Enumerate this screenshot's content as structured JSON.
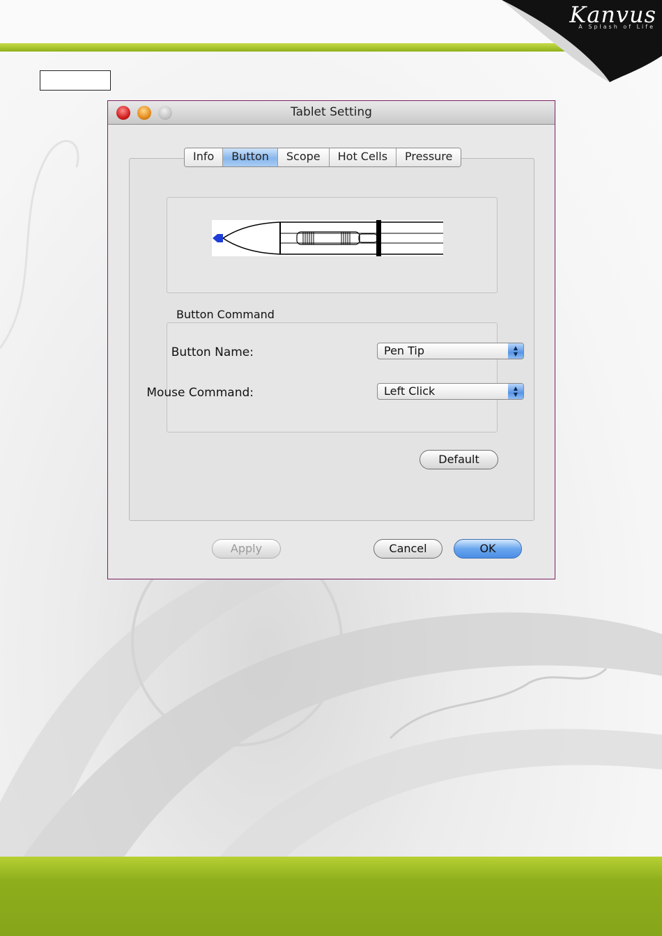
{
  "brand": {
    "name": "Kanvus",
    "tagline": "A Splash of Life"
  },
  "window": {
    "title": "Tablet Setting",
    "tabs": [
      {
        "label": "Info",
        "active": false
      },
      {
        "label": "Button",
        "active": true
      },
      {
        "label": "Scope",
        "active": false
      },
      {
        "label": "Hot Cells",
        "active": false
      },
      {
        "label": "Pressure",
        "active": false
      }
    ],
    "button_command": {
      "group_label": "Button Command",
      "button_name_label": "Button Name:",
      "button_name_value": "Pen Tip",
      "mouse_command_label": "Mouse Command:",
      "mouse_command_value": "Left Click"
    },
    "buttons": {
      "default": "Default",
      "apply": "Apply",
      "cancel": "Cancel",
      "ok": "OK"
    }
  },
  "colors": {
    "accent_green": "#8fb01a",
    "selection_blue": "#6aa6ee",
    "pen_tip_blue": "#1f3dd6"
  }
}
